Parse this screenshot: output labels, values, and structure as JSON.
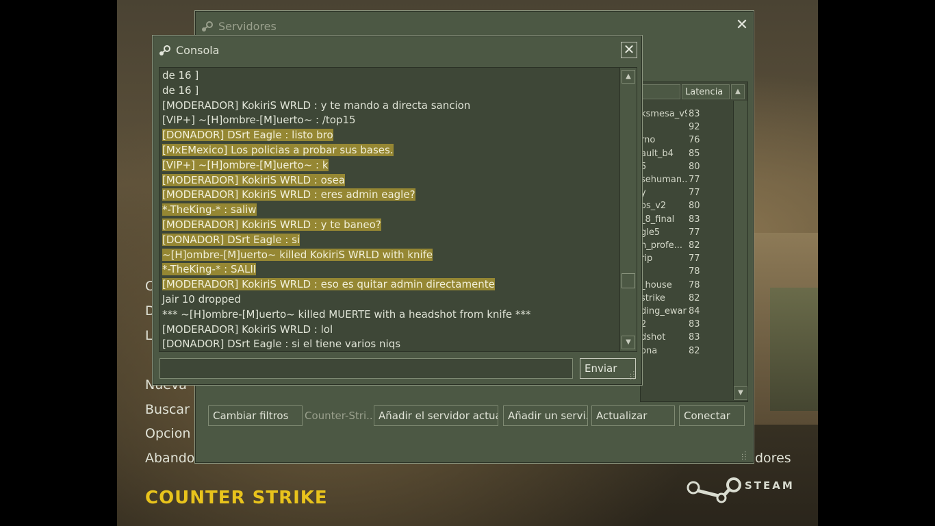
{
  "main_menu": {
    "items": [
      "C",
      "D",
      "L",
      "Nueva",
      "Buscar",
      "Opcion",
      "Abando"
    ],
    "right_partial": "dores"
  },
  "logos": {
    "game": "COUNTER STRIKE",
    "steam": "STEAM"
  },
  "servers_window": {
    "title": "Servidores",
    "column_latency": "Latencia",
    "rows": [
      {
        "name": "ksmesa_v9",
        "latency": "83"
      },
      {
        "name": "",
        "latency": "92"
      },
      {
        "name": "rno",
        "latency": "76"
      },
      {
        "name": "ault_b4",
        "latency": "85"
      },
      {
        "name": "5",
        "latency": "80"
      },
      {
        "name": "sehuman..",
        "latency": "77"
      },
      {
        "name": "y",
        "latency": "77"
      },
      {
        "name": "os_v2",
        "latency": "80"
      },
      {
        "name": "_8_final",
        "latency": "83"
      },
      {
        "name": "gle5",
        "latency": "77"
      },
      {
        "name": "n_profe...",
        "latency": "82"
      },
      {
        "name": "rip",
        "latency": "77"
      },
      {
        "name": "",
        "latency": "78"
      },
      {
        "name": "_house",
        "latency": "78"
      },
      {
        "name": "strike",
        "latency": "82"
      },
      {
        "name": "ding_ewar",
        "latency": "84"
      },
      {
        "name": "2",
        "latency": "83"
      },
      {
        "name": "dshot",
        "latency": "83"
      },
      {
        "name": "ona",
        "latency": "82"
      }
    ],
    "buttons": {
      "change_filters": "Cambiar filtros",
      "game_filter": "Counter-Stri..",
      "add_current": "Añadir el servidor actual",
      "add_server": "Añadir un servi..",
      "refresh": "Actualizar",
      "connect": "Conectar"
    }
  },
  "console": {
    "title": "Consola",
    "lines": [
      {
        "text": "de 16 ]",
        "highlight": false
      },
      {
        "text": "de 16 ]",
        "highlight": false
      },
      {
        "text": "[MODERADOR] KokiriS WRLD : y te mando a directa sancion",
        "highlight": false
      },
      {
        "text": "[VIP+] ~[H]ombre-[M]uerto~ : /top15",
        "highlight": false
      },
      {
        "text": "[DONADOR] DSrt Eagle : listo bro",
        "highlight": true
      },
      {
        "text": "[MxEMexico] Los policias a probar sus bases.",
        "highlight": true
      },
      {
        "text": "[VIP+] ~[H]ombre-[M]uerto~ : k",
        "highlight": true
      },
      {
        "text": "[MODERADOR] KokiriS WRLD : osea",
        "highlight": true
      },
      {
        "text": "[MODERADOR] KokiriS WRLD : eres admin eagle?",
        "highlight": true
      },
      {
        "text": " *-TheKing-* : saliw",
        "highlight": true
      },
      {
        "text": "[MODERADOR] KokiriS WRLD : y te baneo?",
        "highlight": true
      },
      {
        "text": "[DONADOR] DSrt Eagle : si",
        "highlight": true
      },
      {
        "text": "~[H]ombre-[M]uerto~ killed KokiriS WRLD with knife",
        "highlight": true
      },
      {
        "text": " *-TheKing-* : SALII",
        "highlight": true
      },
      {
        "text": "[MODERADOR] KokiriS WRLD : eso es quitar admin directamente",
        "highlight": true
      },
      {
        "text": "Jair 10 dropped",
        "highlight": false
      },
      {
        "text": "*** ~[H]ombre-[M]uerto~ killed MUERTE with a headshot from knife ***",
        "highlight": false
      },
      {
        "text": "[MODERADOR] KokiriS WRLD : lol",
        "highlight": false
      },
      {
        "text": "[DONADOR] DSrt Eagle : si el tiene varios niqs",
        "highlight": false
      }
    ],
    "input_value": "",
    "send_label": "Enviar"
  },
  "colors": {
    "panel": "#4c5844",
    "highlight": "#958733",
    "logo_yellow": "#e8c31c"
  }
}
